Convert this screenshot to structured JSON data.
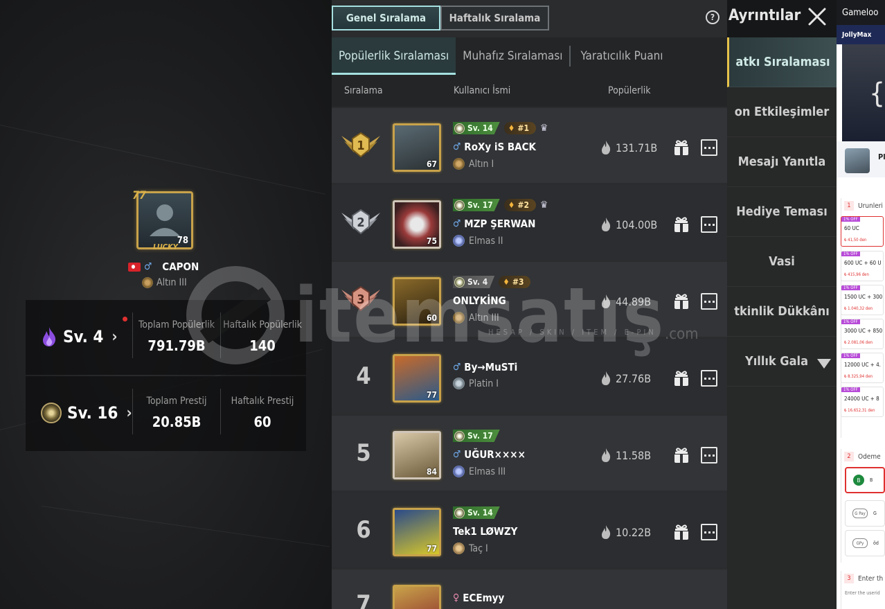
{
  "header": {
    "tabs": [
      {
        "label": "Genel Sıralama",
        "active": true
      },
      {
        "label": "Haftalık Sıralama",
        "active": false
      }
    ],
    "details_label": "Ayrıntılar"
  },
  "subtabs": [
    {
      "label": "Popülerlik Sıralaması",
      "active": true
    },
    {
      "label": "Muhafız Sıralaması",
      "active": false
    },
    {
      "label": "Yaratıcılık Puanı",
      "active": false
    }
  ],
  "columns": {
    "rank": "Sıralama",
    "username": "Kullanıcı İsmi",
    "popularity": "Popülerlik"
  },
  "rows": [
    {
      "rank": "1",
      "name": "RoXy iS BACK",
      "gender": "♂",
      "tier": "Altın I",
      "avatar_level": "67",
      "level_badge": "Sv. 14",
      "rank_badge": "#1",
      "popularity": "131.71B"
    },
    {
      "rank": "2",
      "name": "MZP ŞERWAN",
      "gender": "♂",
      "tier": "Elmas II",
      "avatar_level": "75",
      "level_badge": "Sv. 17",
      "rank_badge": "#2",
      "popularity": "104.00B"
    },
    {
      "rank": "3",
      "name": "ONLYKİNG",
      "gender": "",
      "tier": "Altın III",
      "avatar_level": "60",
      "level_badge": "Sv. 4",
      "rank_badge": "#3",
      "popularity": "44.89B"
    },
    {
      "rank": "4",
      "name": "By→MuSTi",
      "gender": "♂",
      "tier": "Platin I",
      "avatar_level": "77",
      "level_badge": "",
      "rank_badge": "",
      "popularity": "27.76B"
    },
    {
      "rank": "5",
      "name": "UĞUR××××",
      "gender": "♂",
      "tier": "Elmas III",
      "avatar_level": "84",
      "level_badge": "Sv. 17",
      "rank_badge": "",
      "popularity": "11.58B"
    },
    {
      "rank": "6",
      "name": "Tek1 LØWZY",
      "gender": "",
      "tier": "Taç I",
      "avatar_level": "77",
      "level_badge": "Sv. 14",
      "rank_badge": "",
      "popularity": "10.22B"
    },
    {
      "rank": "7",
      "name": "ECEmyy",
      "gender": "♀",
      "tier": "",
      "avatar_level": "",
      "level_badge": "",
      "rank_badge": "",
      "popularity": ""
    }
  ],
  "player": {
    "name": "CAPON",
    "gender": "♂",
    "tier": "Altın III",
    "avatar_level": "78",
    "frame_badge": "77",
    "frame_text": "LUCKY"
  },
  "stats": {
    "popularity": {
      "level": "Sv. 4",
      "total_label": "Toplam Popülerlik",
      "total_value": "791.79B",
      "weekly_label": "Haftalık Popülerlik",
      "weekly_value": "140"
    },
    "prestige": {
      "level": "Sv. 16",
      "total_label": "Toplam Prestij",
      "total_value": "20.85B",
      "weekly_label": "Haftalık Prestij",
      "weekly_value": "60"
    }
  },
  "right_menu": [
    {
      "label": "atkı Sıralaması",
      "active": true
    },
    {
      "label": "on Etkileşimler",
      "active": false
    },
    {
      "label": "Mesajı Yanıtla",
      "active": false
    },
    {
      "label": "Hediye Teması",
      "active": false
    },
    {
      "label": "Vasi",
      "active": false
    },
    {
      "label": "tkinlik Dükkânı",
      "active": false
    },
    {
      "label": "Yıllık Gala",
      "active": false
    }
  ],
  "watermark": {
    "text": "itemsatış",
    "sub": "HESAP / SKIN / ITEM / E-PIN",
    "com": ".com"
  },
  "side_browser": {
    "top_label": "Gameloo",
    "brand": "JollyMax",
    "banner_glyph": "{",
    "game_label": "Pl",
    "section1_num": "1",
    "section1_label": "Urunleri",
    "products": [
      {
        "off": "1% OFF",
        "name": "60 UC",
        "price": "₺ 41,50 den"
      },
      {
        "off": "1% OFF",
        "name": "600 UC + 60 U",
        "price": "₺ 415,96 den"
      },
      {
        "off": "1% OFF",
        "name": "1500 UC + 300",
        "price": "₺ 1.040,32 den"
      },
      {
        "off": "1% OFF",
        "name": "3000 UC + 850",
        "price": "₺ 2.081,06 den"
      },
      {
        "off": "1% OFF",
        "name": "12000 UC + 4.",
        "price": "₺ 8.325,94 den"
      },
      {
        "off": "1% OFF",
        "name": "24000 UC + 8",
        "price": "₺ 16.652,31 den"
      }
    ],
    "section2_num": "2",
    "section2_label": "Odeme",
    "payments": [
      {
        "icon": "B",
        "label": "B"
      },
      {
        "icon": "G Pay",
        "label": "G"
      },
      {
        "icon": "GPy",
        "label": "öd"
      }
    ],
    "section3_num": "3",
    "section3_label": "Enter th",
    "enter_hint": "Enter the userid"
  },
  "colors": {
    "accent_teal": "#a6e0e0",
    "gold": "#c8a24a",
    "level_green": "#4d8f3e"
  }
}
